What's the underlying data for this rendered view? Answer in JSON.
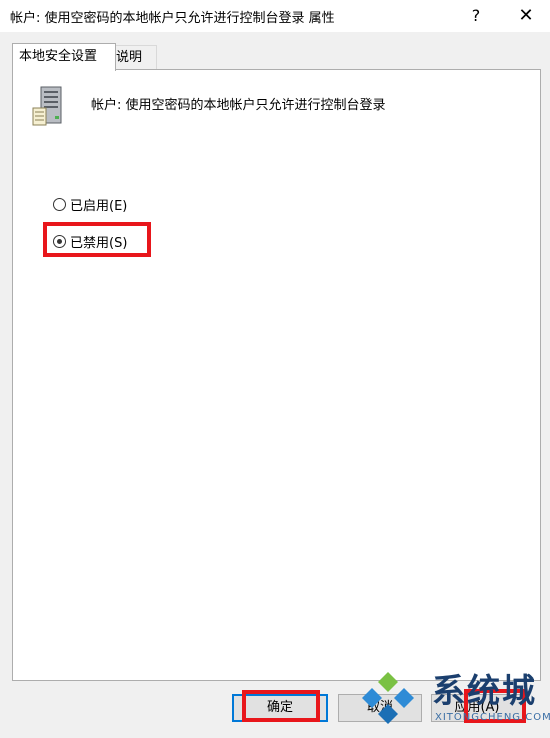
{
  "window": {
    "title": "帐户: 使用空密码的本地帐户只允许进行控制台登录 属性",
    "help_label": "?",
    "close_label": "✕"
  },
  "tabs": [
    {
      "label": "本地安全设置",
      "active": true
    },
    {
      "label": "说明",
      "active": false
    }
  ],
  "policy": {
    "icon": "server-icon",
    "name": "帐户: 使用空密码的本地帐户只允许进行控制台登录"
  },
  "options": [
    {
      "label": "已启用(E)",
      "checked": false
    },
    {
      "label": "已禁用(S)",
      "checked": true
    }
  ],
  "buttons": {
    "ok": "确定",
    "cancel": "取消",
    "apply": "应用(A)"
  },
  "watermark": {
    "brand": "系统城",
    "url": "XITONGCHENG.COM"
  },
  "colors": {
    "highlight": "#e8161b",
    "focus_border": "#0078d7",
    "brand_blue": "#1b3f6e",
    "brand_green": "#2b8a2e"
  }
}
